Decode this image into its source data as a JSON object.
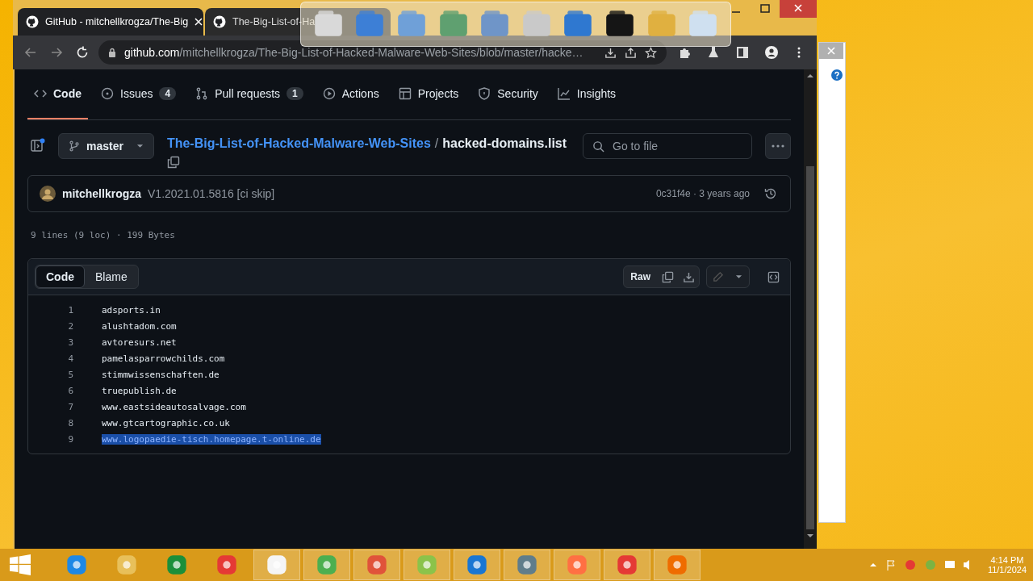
{
  "browser": {
    "tabs": [
      {
        "title": "GitHub - mitchellkrogza/The-Big",
        "selected": true
      },
      {
        "title": "The-Big-List-of-Ha",
        "selected": false
      }
    ],
    "url_host": "github.com",
    "url_path": "/mitchellkrogza/The-Big-List-of-Hacked-Malware-Web-Sites/blob/master/hacke…"
  },
  "repo_nav": [
    {
      "label": "Code",
      "selected": true,
      "kind": "code"
    },
    {
      "label": "Issues",
      "count": "4",
      "selected": false,
      "kind": "issues"
    },
    {
      "label": "Pull requests",
      "count": "1",
      "selected": false,
      "kind": "pulls"
    },
    {
      "label": "Actions",
      "selected": false,
      "kind": "actions"
    },
    {
      "label": "Projects",
      "selected": false,
      "kind": "projects"
    },
    {
      "label": "Security",
      "selected": false,
      "kind": "security"
    },
    {
      "label": "Insights",
      "selected": false,
      "kind": "insights"
    }
  ],
  "file_header": {
    "branch": "master",
    "repo": "The-Big-List-of-Hacked-Malware-Web-Sites",
    "separator": "/",
    "file": "hacked-domains.list",
    "search": {
      "placeholder": "Go to file"
    }
  },
  "commit": {
    "author": "mitchellkrogza",
    "message": "V1.2021.01.5816 [ci skip]",
    "sha_time": "0c31f4e · 3 years ago"
  },
  "file_info": "9 lines (9 loc) · 199 Bytes",
  "view_tabs": [
    {
      "label": "Code",
      "selected": true
    },
    {
      "label": "Blame",
      "selected": false
    }
  ],
  "raw_button": "Raw",
  "lines": [
    {
      "number": "1",
      "text": "adsports.in",
      "selected": false
    },
    {
      "number": "2",
      "text": "alushtadom.com",
      "selected": false
    },
    {
      "number": "3",
      "text": "avtoresurs.net",
      "selected": false
    },
    {
      "number": "4",
      "text": "pamelasparrowchilds.com",
      "selected": false
    },
    {
      "number": "5",
      "text": "stimmwissenschaften.de",
      "selected": false
    },
    {
      "number": "6",
      "text": "truepublish.de",
      "selected": false
    },
    {
      "number": "7",
      "text": "www.eastsideautosalvage.com",
      "selected": false
    },
    {
      "number": "8",
      "text": "www.gtcartographic.co.uk",
      "selected": false
    },
    {
      "number": "9",
      "text": "www.logopaedie-tisch.homepage.t-online.de",
      "selected": true
    }
  ],
  "taskbar": {
    "time": "4:14 PM",
    "date": "11/1/2024"
  }
}
